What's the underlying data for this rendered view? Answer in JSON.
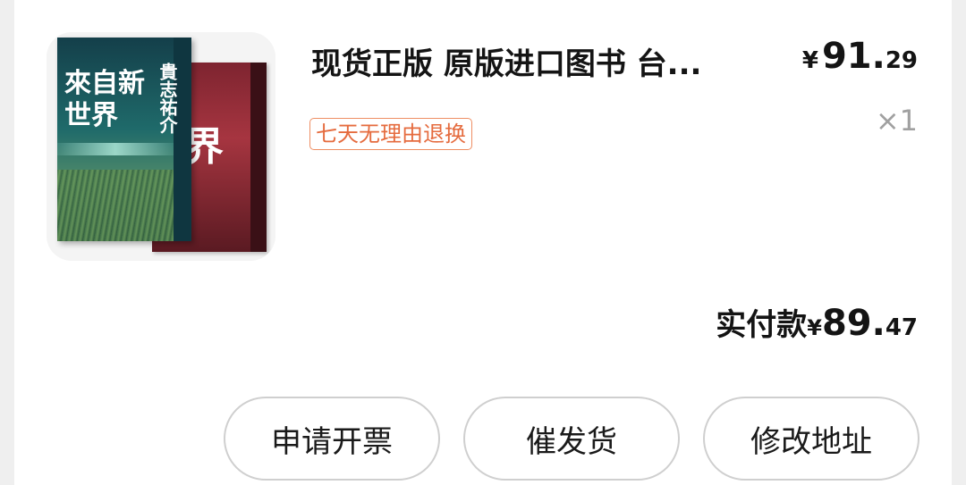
{
  "product": {
    "title": "现货正版 原版进口图书 台...",
    "price_yen": "¥",
    "price_int": "91.",
    "price_dec": "29",
    "tag": "七天无理由退换",
    "quantity": "×1",
    "cover": {
      "title_main": "來自新世界",
      "author_vertical": "貴志祐介",
      "back_char": "界"
    }
  },
  "payment": {
    "label": "实付款",
    "yen": "¥",
    "int": "89.",
    "dec": "47"
  },
  "actions": {
    "invoice": "申请开票",
    "urge": "催发货",
    "address": "修改地址"
  }
}
